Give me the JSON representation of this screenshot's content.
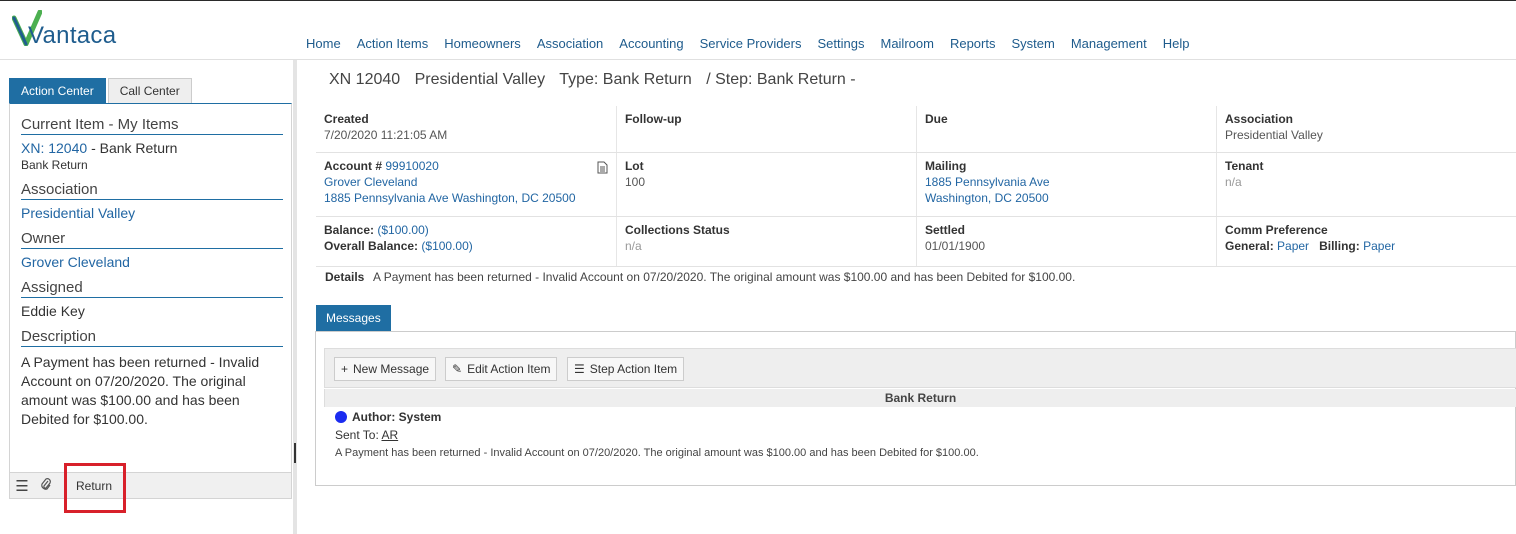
{
  "app": {
    "logo_text": "Vantaca",
    "brand_color": "#1f5d8e",
    "logo_check_color": "#4caf50"
  },
  "nav": [
    "Home",
    "Action Items",
    "Homeowners",
    "Association",
    "Accounting",
    "Service Providers",
    "Settings",
    "Mailroom",
    "Reports",
    "System",
    "Management",
    "Help"
  ],
  "left": {
    "tabs": [
      "Action Center",
      "Call Center"
    ],
    "current_item_heading": "Current Item - My Items",
    "item_link": "XN: 12040",
    "item_type": "- Bank Return",
    "item_subtype": "Bank Return",
    "association_heading": "Association",
    "association_value": "Presidential Valley",
    "owner_heading": "Owner",
    "owner_value": "Grover Cleveland",
    "assigned_heading": "Assigned",
    "assigned_value": "Eddie Key",
    "description_heading": "Description",
    "description_value": "A Payment has been returned - Invalid Account on 07/20/2020. The original amount was $100.00 and has been Debited for $100.00.",
    "footer": {
      "menu_icon": "menu-icon",
      "attach_icon": "paperclip-icon",
      "return_label": "Return"
    }
  },
  "main": {
    "title": {
      "id": "XN 12040",
      "name": "Presidential Valley",
      "type": "Type: Bank Return",
      "step": "/ Step: Bank Return -"
    },
    "row1": {
      "created_label": "Created",
      "created_value": "7/20/2020 11:21:05 AM",
      "followup_label": "Follow-up",
      "due_label": "Due",
      "association_label": "Association",
      "association_value": "Presidential Valley"
    },
    "row2": {
      "account_label": "Account #",
      "account_value": "99910020",
      "owner_name": "Grover Cleveland",
      "owner_address": "1885 Pennsylvania Ave Washington, DC 20500",
      "lot_label": "Lot",
      "lot_value": "100",
      "mailing_label": "Mailing",
      "mailing_line1": "1885 Pennsylvania Ave",
      "mailing_line2": "Washington, DC 20500",
      "tenant_label": "Tenant",
      "tenant_value": "n/a"
    },
    "row3": {
      "balance_label": "Balance:",
      "balance_value": "($100.00)",
      "overall_label": "Overall Balance:",
      "overall_value": "($100.00)",
      "collections_label": "Collections Status",
      "collections_value": "n/a",
      "settled_label": "Settled",
      "settled_value": "01/01/1900",
      "comm_label": "Comm Preference",
      "general_label": "General:",
      "general_value": "Paper",
      "billing_label": "Billing:",
      "billing_value": "Paper"
    },
    "details_label": "Details",
    "details_value": "A Payment has been returned - Invalid Account on 07/20/2020. The original amount was $100.00 and has been Debited for $100.00."
  },
  "messages": {
    "tab": "Messages",
    "new_message": "New Message",
    "edit_action_item": "Edit Action Item",
    "step_action_item": "Step Action Item",
    "header": "Bank Return",
    "author": "Author: System",
    "sent_to_label": "Sent To:",
    "sent_to_value": "AR",
    "body": "A Payment has been returned - Invalid Account on 07/20/2020. The original amount was $100.00 and has been Debited for $100.00."
  }
}
